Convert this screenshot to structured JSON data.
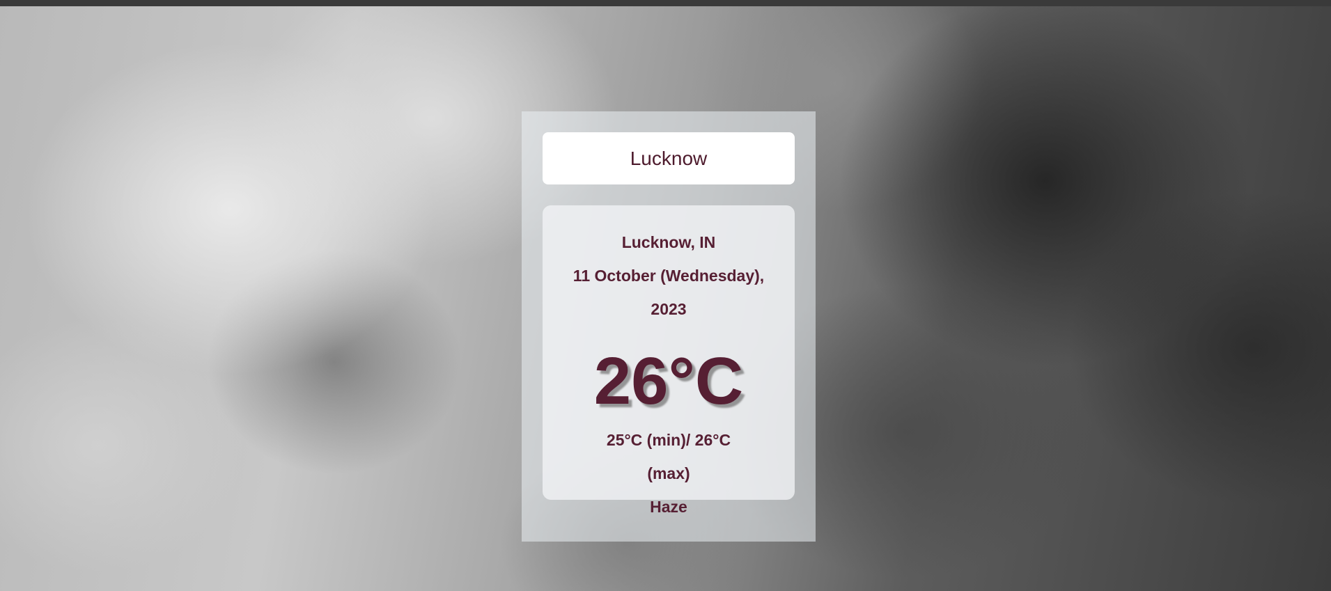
{
  "search": {
    "value": "Lucknow"
  },
  "weather": {
    "location": "Lucknow, IN",
    "date_line1": "11 October (Wednesday),",
    "date_line2": "2023",
    "temperature": "26°C",
    "minmax_line1": "25°C (min)/ 26°C",
    "minmax_line2": "(max)",
    "condition": "Haze"
  },
  "colors": {
    "text": "#561f33",
    "search_bg": "#ffffff"
  }
}
